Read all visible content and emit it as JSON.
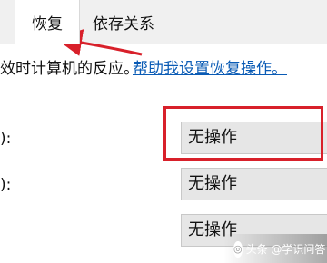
{
  "tabs": {
    "prev": "",
    "recovery": "恢复",
    "dependencies": "依存关系"
  },
  "description": {
    "text": "效时计算机的反应。",
    "help_link": "帮助我设置恢复操作。"
  },
  "rows": [
    {
      "label": "):",
      "value": "无操作"
    },
    {
      "label": "):",
      "value": "无操作"
    },
    {
      "label": "",
      "value": "无操作"
    }
  ],
  "annotation": {
    "arrow_color": "#d8202a",
    "highlight_color": "#d8202a"
  },
  "watermark": {
    "text": "头条 @学识问答"
  }
}
